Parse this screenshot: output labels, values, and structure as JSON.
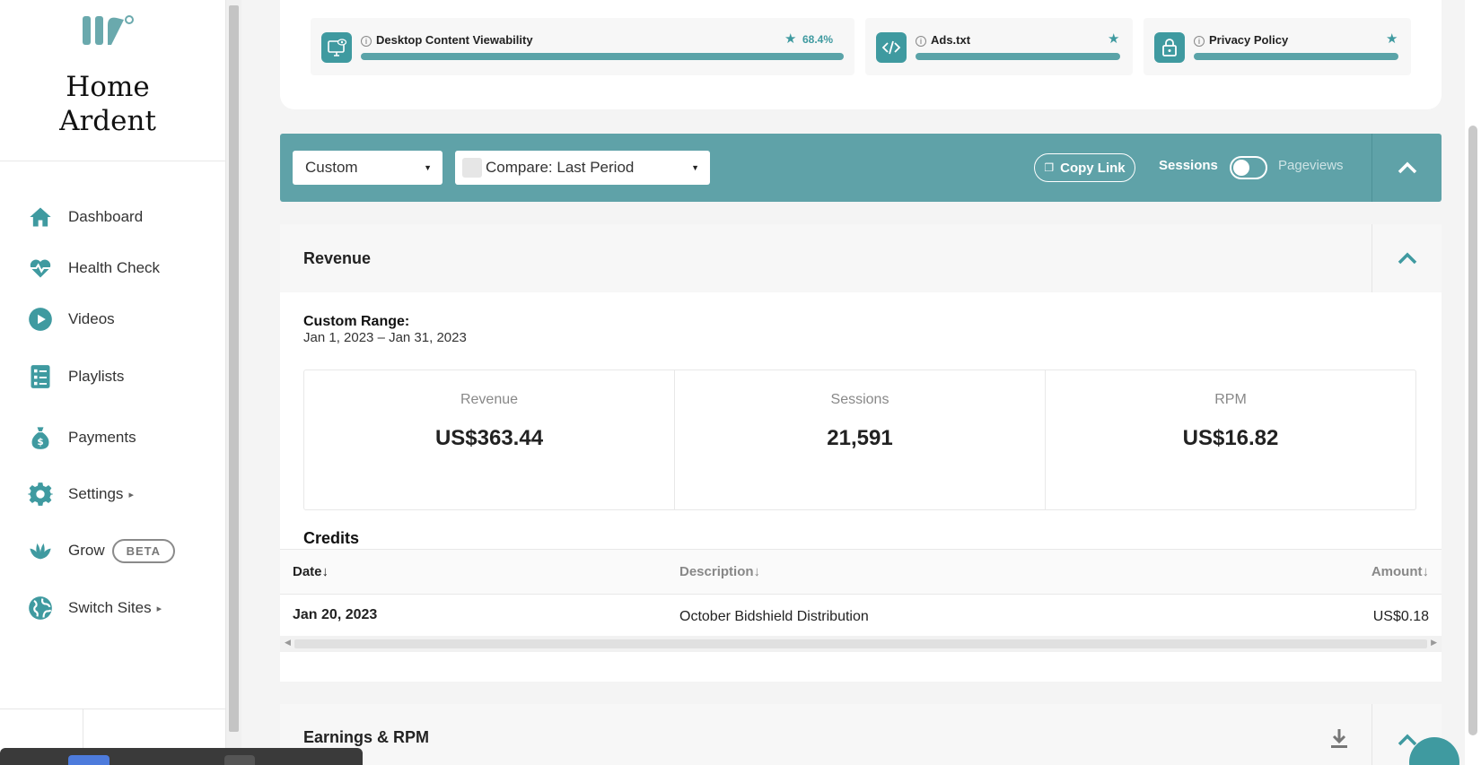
{
  "brand": {
    "name": "Home Ardent"
  },
  "sidebar": {
    "items": [
      {
        "label": "Dashboard",
        "icon": "home-icon"
      },
      {
        "label": "Health Check",
        "icon": "heartbeat-icon"
      },
      {
        "label": "Videos",
        "icon": "play-icon"
      },
      {
        "label": "Playlists",
        "icon": "list-icon"
      },
      {
        "label": "Payments",
        "icon": "money-bag-icon"
      },
      {
        "label": "Settings",
        "icon": "gear-icon",
        "caret": "▸"
      },
      {
        "label": "Grow",
        "icon": "leaf-icon",
        "badge": "BETA"
      },
      {
        "label": "Switch Sites",
        "icon": "globe-icon",
        "caret": "▸"
      }
    ]
  },
  "health_checks": [
    {
      "name": "Desktop Content Viewability",
      "value": "68.4%",
      "icon": "monitor-eye-icon",
      "progress": 1.0
    },
    {
      "name": "Ads.txt",
      "value": "",
      "icon": "code-icon",
      "progress": 1.0
    },
    {
      "name": "Privacy Policy",
      "value": "",
      "icon": "lock-icon",
      "progress": 1.0
    }
  ],
  "filter": {
    "range_select": "Custom",
    "compare_select": "Compare: Last Period",
    "copy_link": "Copy Link",
    "toggle_left": "Sessions",
    "toggle_right": "Pageviews"
  },
  "revenue": {
    "title": "Revenue",
    "range_label": "Custom Range:",
    "range_value": "Jan 1, 2023 – Jan 31, 2023",
    "stats": [
      {
        "label": "Revenue",
        "value": "US$363.44"
      },
      {
        "label": "Sessions",
        "value": "21,591"
      },
      {
        "label": "RPM",
        "value": "US$16.82"
      }
    ],
    "credits": {
      "title": "Credits",
      "columns": [
        "Date↓",
        "Description↓",
        "Amount↓"
      ],
      "rows": [
        {
          "date": "Jan 20, 2023",
          "description": "October Bidshield Distribution",
          "amount": "US$0.18"
        }
      ]
    }
  },
  "earnings": {
    "title": "Earnings & RPM"
  },
  "colors": {
    "accent": "#5fa2a8",
    "accent_dark": "#3f9aa0"
  }
}
